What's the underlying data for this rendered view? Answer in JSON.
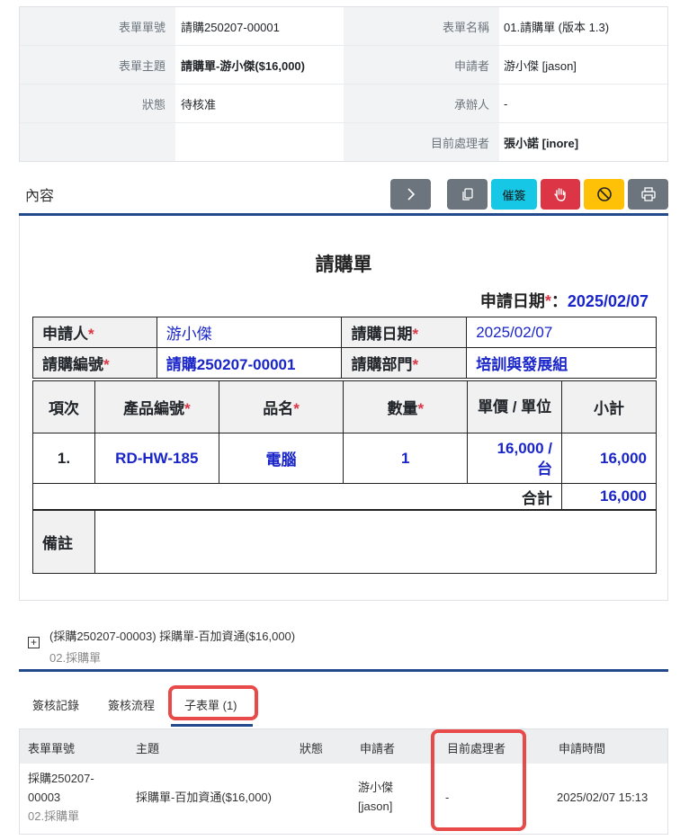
{
  "info": {
    "form_no_label": "表單單號",
    "form_no": "請購250207-00001",
    "form_name_label": "表單名稱",
    "form_name": "01.請購單 (版本 1.3)",
    "subject_label": "表單主題",
    "subject": "請購單-游小傑($16,000)",
    "applicant_label": "申請者",
    "applicant": "游小傑 [jason]",
    "status_label": "狀態",
    "status": "待核准",
    "handler_label": "承辦人",
    "handler": "-",
    "current_label": "目前處理者",
    "current": "張小諾 [inore]"
  },
  "content": {
    "title": "內容",
    "remind_label": "催簽"
  },
  "form": {
    "title": "請購單",
    "apply_date_label": "申請日期",
    "apply_date": "2025/02/07",
    "applicant_label": "申請人",
    "applicant": "游小傑",
    "date_label": "請購日期",
    "date": "2025/02/07",
    "no_label": "請購編號",
    "no": "請購250207-00001",
    "dept_label": "請購部門",
    "dept": "培訓與發展組",
    "col_item": "項次",
    "col_code": "產品編號",
    "col_name": "品名",
    "col_qty": "數量",
    "col_price": "單價 / 單位",
    "col_subtotal": "小計",
    "row_item": "1.",
    "row_code": "RD-HW-185",
    "row_name": "電腦",
    "row_qty": "1",
    "row_price": "16,000 /",
    "row_unit": "台",
    "row_subtotal": "16,000",
    "total_label": "合計",
    "total": "16,000",
    "remark_label": "備註",
    "required_mark": "*"
  },
  "parent": {
    "text": "(採購250207-00003) 採購單-百加資通($16,000)",
    "sub": "02.採購單"
  },
  "tabs": {
    "log": "簽核記錄",
    "flow": "簽核流程",
    "sub": "子表單 (1)"
  },
  "list": {
    "h_no": "表單單號",
    "h_subject": "主題",
    "h_status": "狀態",
    "h_applicant": "申請者",
    "h_current": "目前處理者",
    "h_time": "申請時間",
    "r_no1": "採購250207-",
    "r_no2": "00003",
    "r_form": "02.採購單",
    "r_subject": "採購單-百加資通($16,000)",
    "r_applicant1": "游小傑",
    "r_applicant2": "[jason]",
    "r_current": "-",
    "r_time": "2025/02/07 15:13"
  }
}
